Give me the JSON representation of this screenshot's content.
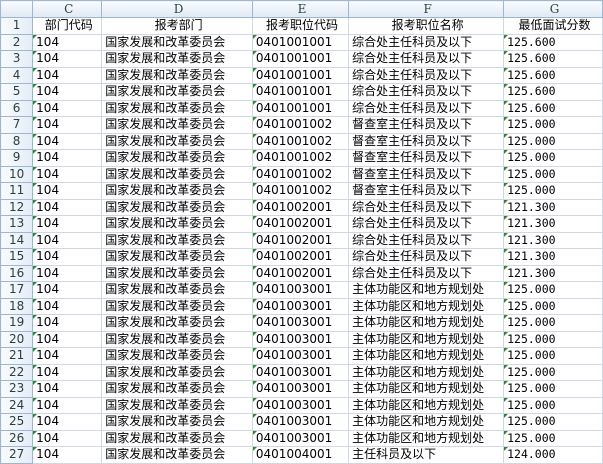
{
  "columns": [
    "C",
    "D",
    "E",
    "F",
    "G"
  ],
  "headers": [
    "部门代码",
    "报考部门",
    "报考职位代码",
    "报考职位名称",
    "最低面试分数"
  ],
  "rows": [
    [
      "2",
      "104",
      "国家发展和改革委员会",
      "0401001001",
      "综合处主任科员及以下",
      "125.600"
    ],
    [
      "3",
      "104",
      "国家发展和改革委员会",
      "0401001001",
      "综合处主任科员及以下",
      "125.600"
    ],
    [
      "4",
      "104",
      "国家发展和改革委员会",
      "0401001001",
      "综合处主任科员及以下",
      "125.600"
    ],
    [
      "5",
      "104",
      "国家发展和改革委员会",
      "0401001001",
      "综合处主任科员及以下",
      "125.600"
    ],
    [
      "6",
      "104",
      "国家发展和改革委员会",
      "0401001001",
      "综合处主任科员及以下",
      "125.600"
    ],
    [
      "7",
      "104",
      "国家发展和改革委员会",
      "0401001002",
      "督查室主任科员及以下",
      "125.000"
    ],
    [
      "8",
      "104",
      "国家发展和改革委员会",
      "0401001002",
      "督查室主任科员及以下",
      "125.000"
    ],
    [
      "9",
      "104",
      "国家发展和改革委员会",
      "0401001002",
      "督查室主任科员及以下",
      "125.000"
    ],
    [
      "10",
      "104",
      "国家发展和改革委员会",
      "0401001002",
      "督查室主任科员及以下",
      "125.000"
    ],
    [
      "11",
      "104",
      "国家发展和改革委员会",
      "0401001002",
      "督查室主任科员及以下",
      "125.000"
    ],
    [
      "12",
      "104",
      "国家发展和改革委员会",
      "0401002001",
      "综合处主任科员及以下",
      "121.300"
    ],
    [
      "13",
      "104",
      "国家发展和改革委员会",
      "0401002001",
      "综合处主任科员及以下",
      "121.300"
    ],
    [
      "14",
      "104",
      "国家发展和改革委员会",
      "0401002001",
      "综合处主任科员及以下",
      "121.300"
    ],
    [
      "15",
      "104",
      "国家发展和改革委员会",
      "0401002001",
      "综合处主任科员及以下",
      "121.300"
    ],
    [
      "16",
      "104",
      "国家发展和改革委员会",
      "0401002001",
      "综合处主任科员及以下",
      "121.300"
    ],
    [
      "17",
      "104",
      "国家发展和改革委员会",
      "0401003001",
      "主体功能区和地方规划处",
      "125.000"
    ],
    [
      "18",
      "104",
      "国家发展和改革委员会",
      "0401003001",
      "主体功能区和地方规划处",
      "125.000"
    ],
    [
      "19",
      "104",
      "国家发展和改革委员会",
      "0401003001",
      "主体功能区和地方规划处",
      "125.000"
    ],
    [
      "20",
      "104",
      "国家发展和改革委员会",
      "0401003001",
      "主体功能区和地方规划处",
      "125.000"
    ],
    [
      "21",
      "104",
      "国家发展和改革委员会",
      "0401003001",
      "主体功能区和地方规划处",
      "125.000"
    ],
    [
      "22",
      "104",
      "国家发展和改革委员会",
      "0401003001",
      "主体功能区和地方规划处",
      "125.000"
    ],
    [
      "23",
      "104",
      "国家发展和改革委员会",
      "0401003001",
      "主体功能区和地方规划处",
      "125.000"
    ],
    [
      "24",
      "104",
      "国家发展和改革委员会",
      "0401003001",
      "主体功能区和地方规划处",
      "125.000"
    ],
    [
      "25",
      "104",
      "国家发展和改革委员会",
      "0401003001",
      "主体功能区和地方规划处",
      "125.000"
    ],
    [
      "26",
      "104",
      "国家发展和改革委员会",
      "0401003001",
      "主体功能区和地方规划处",
      "125.000"
    ],
    [
      "27",
      "104",
      "国家发展和改革委员会",
      "0401004001",
      "主任科员及以下",
      "124.000"
    ]
  ]
}
